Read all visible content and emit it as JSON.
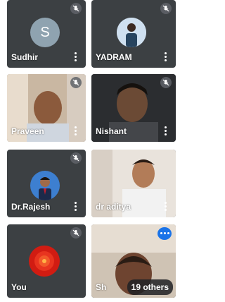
{
  "participants": [
    {
      "name": "Sudhir",
      "avatar_letter": "S",
      "muted": true
    },
    {
      "name": "YADRAM",
      "muted": true
    },
    {
      "name": "Praveen",
      "muted": true
    },
    {
      "name": "Nishant",
      "muted": true
    },
    {
      "name": "Dr.Rajesh",
      "muted": true
    },
    {
      "name": "dr aditya",
      "muted": false
    },
    {
      "name": "You",
      "muted": true
    },
    {
      "name": "Sh",
      "muted": false
    }
  ],
  "others_label": "19 others",
  "colors": {
    "tile_bg": "#3c4043",
    "accent": "#1a73e8"
  }
}
